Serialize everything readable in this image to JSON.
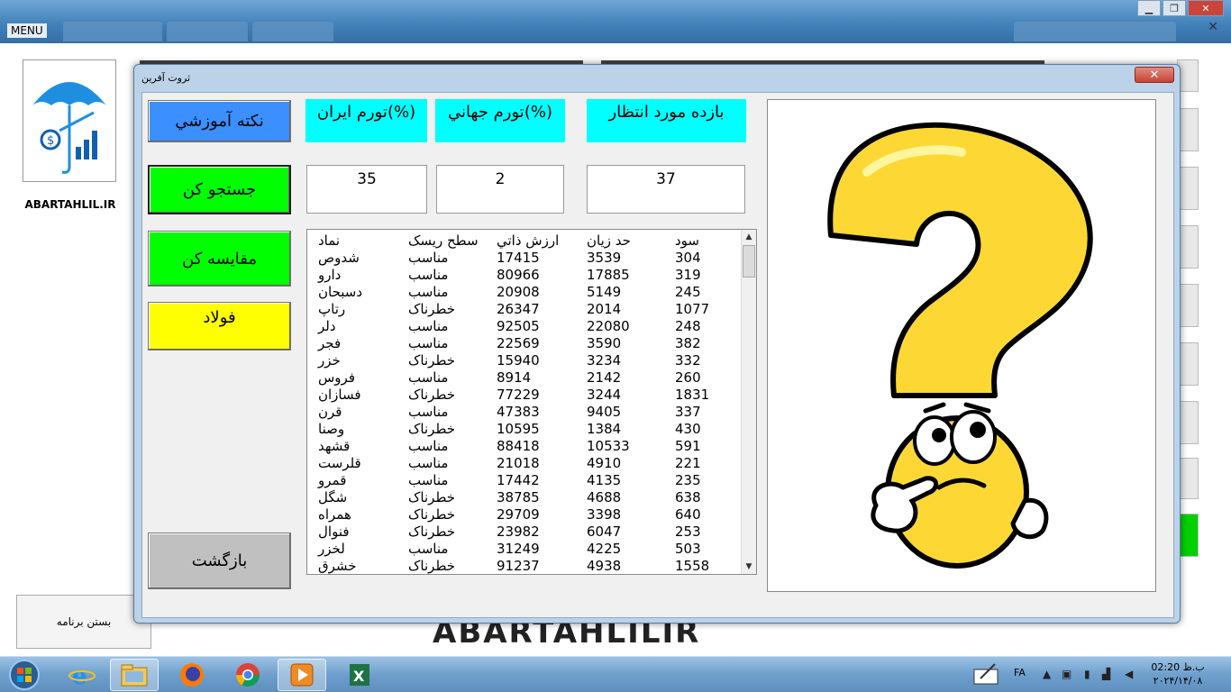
{
  "window": {
    "menu_label": "MENU",
    "close_symbol": "✕",
    "minimize_symbol": "▁",
    "restore_symbol": "❐"
  },
  "background_app": {
    "logo_text": "ABARTAHLIL.IR",
    "close_program_label": "بستن برنامه",
    "watermark": "ABARTAHLILIR"
  },
  "dialog": {
    "title": "ثروت آفرین",
    "close_symbol": "✕",
    "buttons": {
      "educational_tip": "نکته آموزشي",
      "search": "جستجو کن",
      "compare": "مقايسه کن",
      "steel": "فولاد",
      "back": "بازگشت"
    },
    "indicators": {
      "iran_inflation_label": "تورم ايران(%)",
      "world_inflation_label": "تورم جهاني(%)",
      "expected_return_label": "بازده مورد انتظار",
      "iran_inflation_value": "35",
      "world_inflation_value": "2",
      "expected_return_value": "37"
    },
    "table": {
      "headers": {
        "name": "نماد",
        "risk": "سطح ريسک",
        "intrinsic_value": "ارزش ذاتي",
        "loss_limit": "حد زيان",
        "profit": "سود"
      },
      "rows": [
        {
          "name": "شدوص",
          "risk": "مناسب",
          "intrinsic_value": "17415",
          "loss_limit": "3539",
          "profit": "304"
        },
        {
          "name": "دارو",
          "risk": "مناسب",
          "intrinsic_value": "80966",
          "loss_limit": "17885",
          "profit": "319"
        },
        {
          "name": "دسبحان",
          "risk": "مناسب",
          "intrinsic_value": "20908",
          "loss_limit": "5149",
          "profit": "245"
        },
        {
          "name": "رتاپ",
          "risk": "خطرناک",
          "intrinsic_value": "26347",
          "loss_limit": "2014",
          "profit": "1077"
        },
        {
          "name": "دلر",
          "risk": "مناسب",
          "intrinsic_value": "92505",
          "loss_limit": "22080",
          "profit": "248"
        },
        {
          "name": "فجر",
          "risk": "مناسب",
          "intrinsic_value": "22569",
          "loss_limit": "3590",
          "profit": "382"
        },
        {
          "name": "خزر",
          "risk": "خطرناک",
          "intrinsic_value": "15940",
          "loss_limit": "3234",
          "profit": "332"
        },
        {
          "name": "فروس",
          "risk": "مناسب",
          "intrinsic_value": "8914",
          "loss_limit": "2142",
          "profit": "260"
        },
        {
          "name": "فسازان",
          "risk": "خطرناک",
          "intrinsic_value": "77229",
          "loss_limit": "3244",
          "profit": "1831"
        },
        {
          "name": "قرن",
          "risk": "مناسب",
          "intrinsic_value": "47383",
          "loss_limit": "9405",
          "profit": "337"
        },
        {
          "name": "وصنا",
          "risk": "خطرناک",
          "intrinsic_value": "10595",
          "loss_limit": "1384",
          "profit": "430"
        },
        {
          "name": "قشهد",
          "risk": "مناسب",
          "intrinsic_value": "88418",
          "loss_limit": "10533",
          "profit": "591"
        },
        {
          "name": "قلرست",
          "risk": "مناسب",
          "intrinsic_value": "21018",
          "loss_limit": "4910",
          "profit": "221"
        },
        {
          "name": "قمرو",
          "risk": "مناسب",
          "intrinsic_value": "17442",
          "loss_limit": "4135",
          "profit": "235"
        },
        {
          "name": "شگل",
          "risk": "خطرناک",
          "intrinsic_value": "38785",
          "loss_limit": "4688",
          "profit": "638"
        },
        {
          "name": "همراه",
          "risk": "خطرناک",
          "intrinsic_value": "29709",
          "loss_limit": "3398",
          "profit": "640"
        },
        {
          "name": "فنوال",
          "risk": "خطرناک",
          "intrinsic_value": "23982",
          "loss_limit": "6047",
          "profit": "253"
        },
        {
          "name": "لخزر",
          "risk": "مناسب",
          "intrinsic_value": "31249",
          "loss_limit": "4225",
          "profit": "503"
        },
        {
          "name": "خشرق",
          "risk": "خطرناک",
          "intrinsic_value": "91237",
          "loss_limit": "4938",
          "profit": "1558"
        }
      ]
    },
    "picture": {
      "icon": "question-mark-thinking-face-icon"
    }
  },
  "taskbar": {
    "items": [
      "windows-start-icon",
      "internet-explorer-icon",
      "file-explorer-icon",
      "firefox-icon",
      "chrome-icon",
      "media-player-icon",
      "excel-icon"
    ],
    "language": "FA",
    "time": "02:20 ب.ظ",
    "date": "۲۰۲۴/۱۴/۰۸"
  },
  "colors": {
    "cyan_label": "#00ffff",
    "blue_button": "#3b8fff",
    "green_button": "#00ff00",
    "yellow_button": "#ffff00",
    "gray_button": "#c0c0c0"
  }
}
